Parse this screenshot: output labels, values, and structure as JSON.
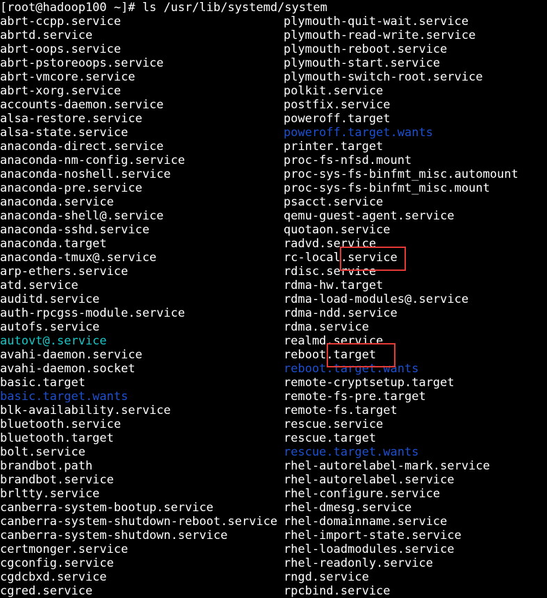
{
  "terminal": {
    "prompt": "[root@hadoop100 ~]# ls /usr/lib/systemd/system",
    "left_column": [
      {
        "text": "abrt-ccpp.service",
        "kind": "file"
      },
      {
        "text": "abrtd.service",
        "kind": "file"
      },
      {
        "text": "abrt-oops.service",
        "kind": "file"
      },
      {
        "text": "abrt-pstoreoops.service",
        "kind": "file"
      },
      {
        "text": "abrt-vmcore.service",
        "kind": "file"
      },
      {
        "text": "abrt-xorg.service",
        "kind": "file"
      },
      {
        "text": "accounts-daemon.service",
        "kind": "file"
      },
      {
        "text": "alsa-restore.service",
        "kind": "file"
      },
      {
        "text": "alsa-state.service",
        "kind": "file"
      },
      {
        "text": "anaconda-direct.service",
        "kind": "file"
      },
      {
        "text": "anaconda-nm-config.service",
        "kind": "file"
      },
      {
        "text": "anaconda-noshell.service",
        "kind": "file"
      },
      {
        "text": "anaconda-pre.service",
        "kind": "file"
      },
      {
        "text": "anaconda.service",
        "kind": "file"
      },
      {
        "text": "anaconda-shell@.service",
        "kind": "file"
      },
      {
        "text": "anaconda-sshd.service",
        "kind": "file"
      },
      {
        "text": "anaconda.target",
        "kind": "file"
      },
      {
        "text": "anaconda-tmux@.service",
        "kind": "file"
      },
      {
        "text": "arp-ethers.service",
        "kind": "file"
      },
      {
        "text": "atd.service",
        "kind": "file"
      },
      {
        "text": "auditd.service",
        "kind": "file"
      },
      {
        "text": "auth-rpcgss-module.service",
        "kind": "file"
      },
      {
        "text": "autofs.service",
        "kind": "file"
      },
      {
        "text": "autovt@.service",
        "kind": "link"
      },
      {
        "text": "avahi-daemon.service",
        "kind": "file"
      },
      {
        "text": "avahi-daemon.socket",
        "kind": "file"
      },
      {
        "text": "basic.target",
        "kind": "file"
      },
      {
        "text": "basic.target.wants",
        "kind": "dir"
      },
      {
        "text": "blk-availability.service",
        "kind": "file"
      },
      {
        "text": "bluetooth.service",
        "kind": "file"
      },
      {
        "text": "bluetooth.target",
        "kind": "file"
      },
      {
        "text": "bolt.service",
        "kind": "file"
      },
      {
        "text": "brandbot.path",
        "kind": "file"
      },
      {
        "text": "brandbot.service",
        "kind": "file"
      },
      {
        "text": "brltty.service",
        "kind": "file"
      },
      {
        "text": "canberra-system-bootup.service",
        "kind": "file"
      },
      {
        "text": "canberra-system-shutdown-reboot.service",
        "kind": "file"
      },
      {
        "text": "canberra-system-shutdown.service",
        "kind": "file"
      },
      {
        "text": "certmonger.service",
        "kind": "file"
      },
      {
        "text": "cgconfig.service",
        "kind": "file"
      },
      {
        "text": "cgdcbxd.service",
        "kind": "file"
      },
      {
        "text": "cgred.service",
        "kind": "file"
      }
    ],
    "right_column": [
      {
        "text": "plymouth-quit-wait.service",
        "kind": "file"
      },
      {
        "text": "plymouth-read-write.service",
        "kind": "file"
      },
      {
        "text": "plymouth-reboot.service",
        "kind": "file"
      },
      {
        "text": "plymouth-start.service",
        "kind": "file"
      },
      {
        "text": "plymouth-switch-root.service",
        "kind": "file"
      },
      {
        "text": "polkit.service",
        "kind": "file"
      },
      {
        "text": "postfix.service",
        "kind": "file"
      },
      {
        "text": "poweroff.target",
        "kind": "file"
      },
      {
        "text": "poweroff.target.wants",
        "kind": "dir"
      },
      {
        "text": "printer.target",
        "kind": "file"
      },
      {
        "text": "proc-fs-nfsd.mount",
        "kind": "file"
      },
      {
        "text": "proc-sys-fs-binfmt_misc.automount",
        "kind": "file"
      },
      {
        "text": "proc-sys-fs-binfmt_misc.mount",
        "kind": "file"
      },
      {
        "text": "psacct.service",
        "kind": "file"
      },
      {
        "text": "qemu-guest-agent.service",
        "kind": "file"
      },
      {
        "text": "quotaon.service",
        "kind": "file"
      },
      {
        "text": "radvd.service",
        "kind": "file"
      },
      {
        "text": "rc-local.service",
        "kind": "file"
      },
      {
        "text": "rdisc.service",
        "kind": "file"
      },
      {
        "text": "rdma-hw.target",
        "kind": "file"
      },
      {
        "text": "rdma-load-modules@.service",
        "kind": "file"
      },
      {
        "text": "rdma-ndd.service",
        "kind": "file"
      },
      {
        "text": "rdma.service",
        "kind": "file"
      },
      {
        "text": "realmd.service",
        "kind": "file"
      },
      {
        "text": "reboot.target",
        "kind": "file"
      },
      {
        "text": "reboot.target.wants",
        "kind": "dir"
      },
      {
        "text": "remote-cryptsetup.target",
        "kind": "file"
      },
      {
        "text": "remote-fs-pre.target",
        "kind": "file"
      },
      {
        "text": "remote-fs.target",
        "kind": "file"
      },
      {
        "text": "rescue.service",
        "kind": "file"
      },
      {
        "text": "rescue.target",
        "kind": "file"
      },
      {
        "text": "rescue.target.wants",
        "kind": "dir"
      },
      {
        "text": "rhel-autorelabel-mark.service",
        "kind": "file"
      },
      {
        "text": "rhel-autorelabel.service",
        "kind": "file"
      },
      {
        "text": "rhel-configure.service",
        "kind": "file"
      },
      {
        "text": "rhel-dmesg.service",
        "kind": "file"
      },
      {
        "text": "rhel-domainname.service",
        "kind": "file"
      },
      {
        "text": "rhel-import-state.service",
        "kind": "file"
      },
      {
        "text": "rhel-loadmodules.service",
        "kind": "file"
      },
      {
        "text": "rhel-readonly.service",
        "kind": "file"
      },
      {
        "text": "rngd.service",
        "kind": "file"
      },
      {
        "text": "rpcbind.service",
        "kind": "file"
      }
    ],
    "colors": {
      "background": "#000000",
      "text": "#ffffff",
      "directory": "#1d4fd1",
      "symlink": "#18c6c6",
      "highlight_box": "#e53935"
    }
  }
}
